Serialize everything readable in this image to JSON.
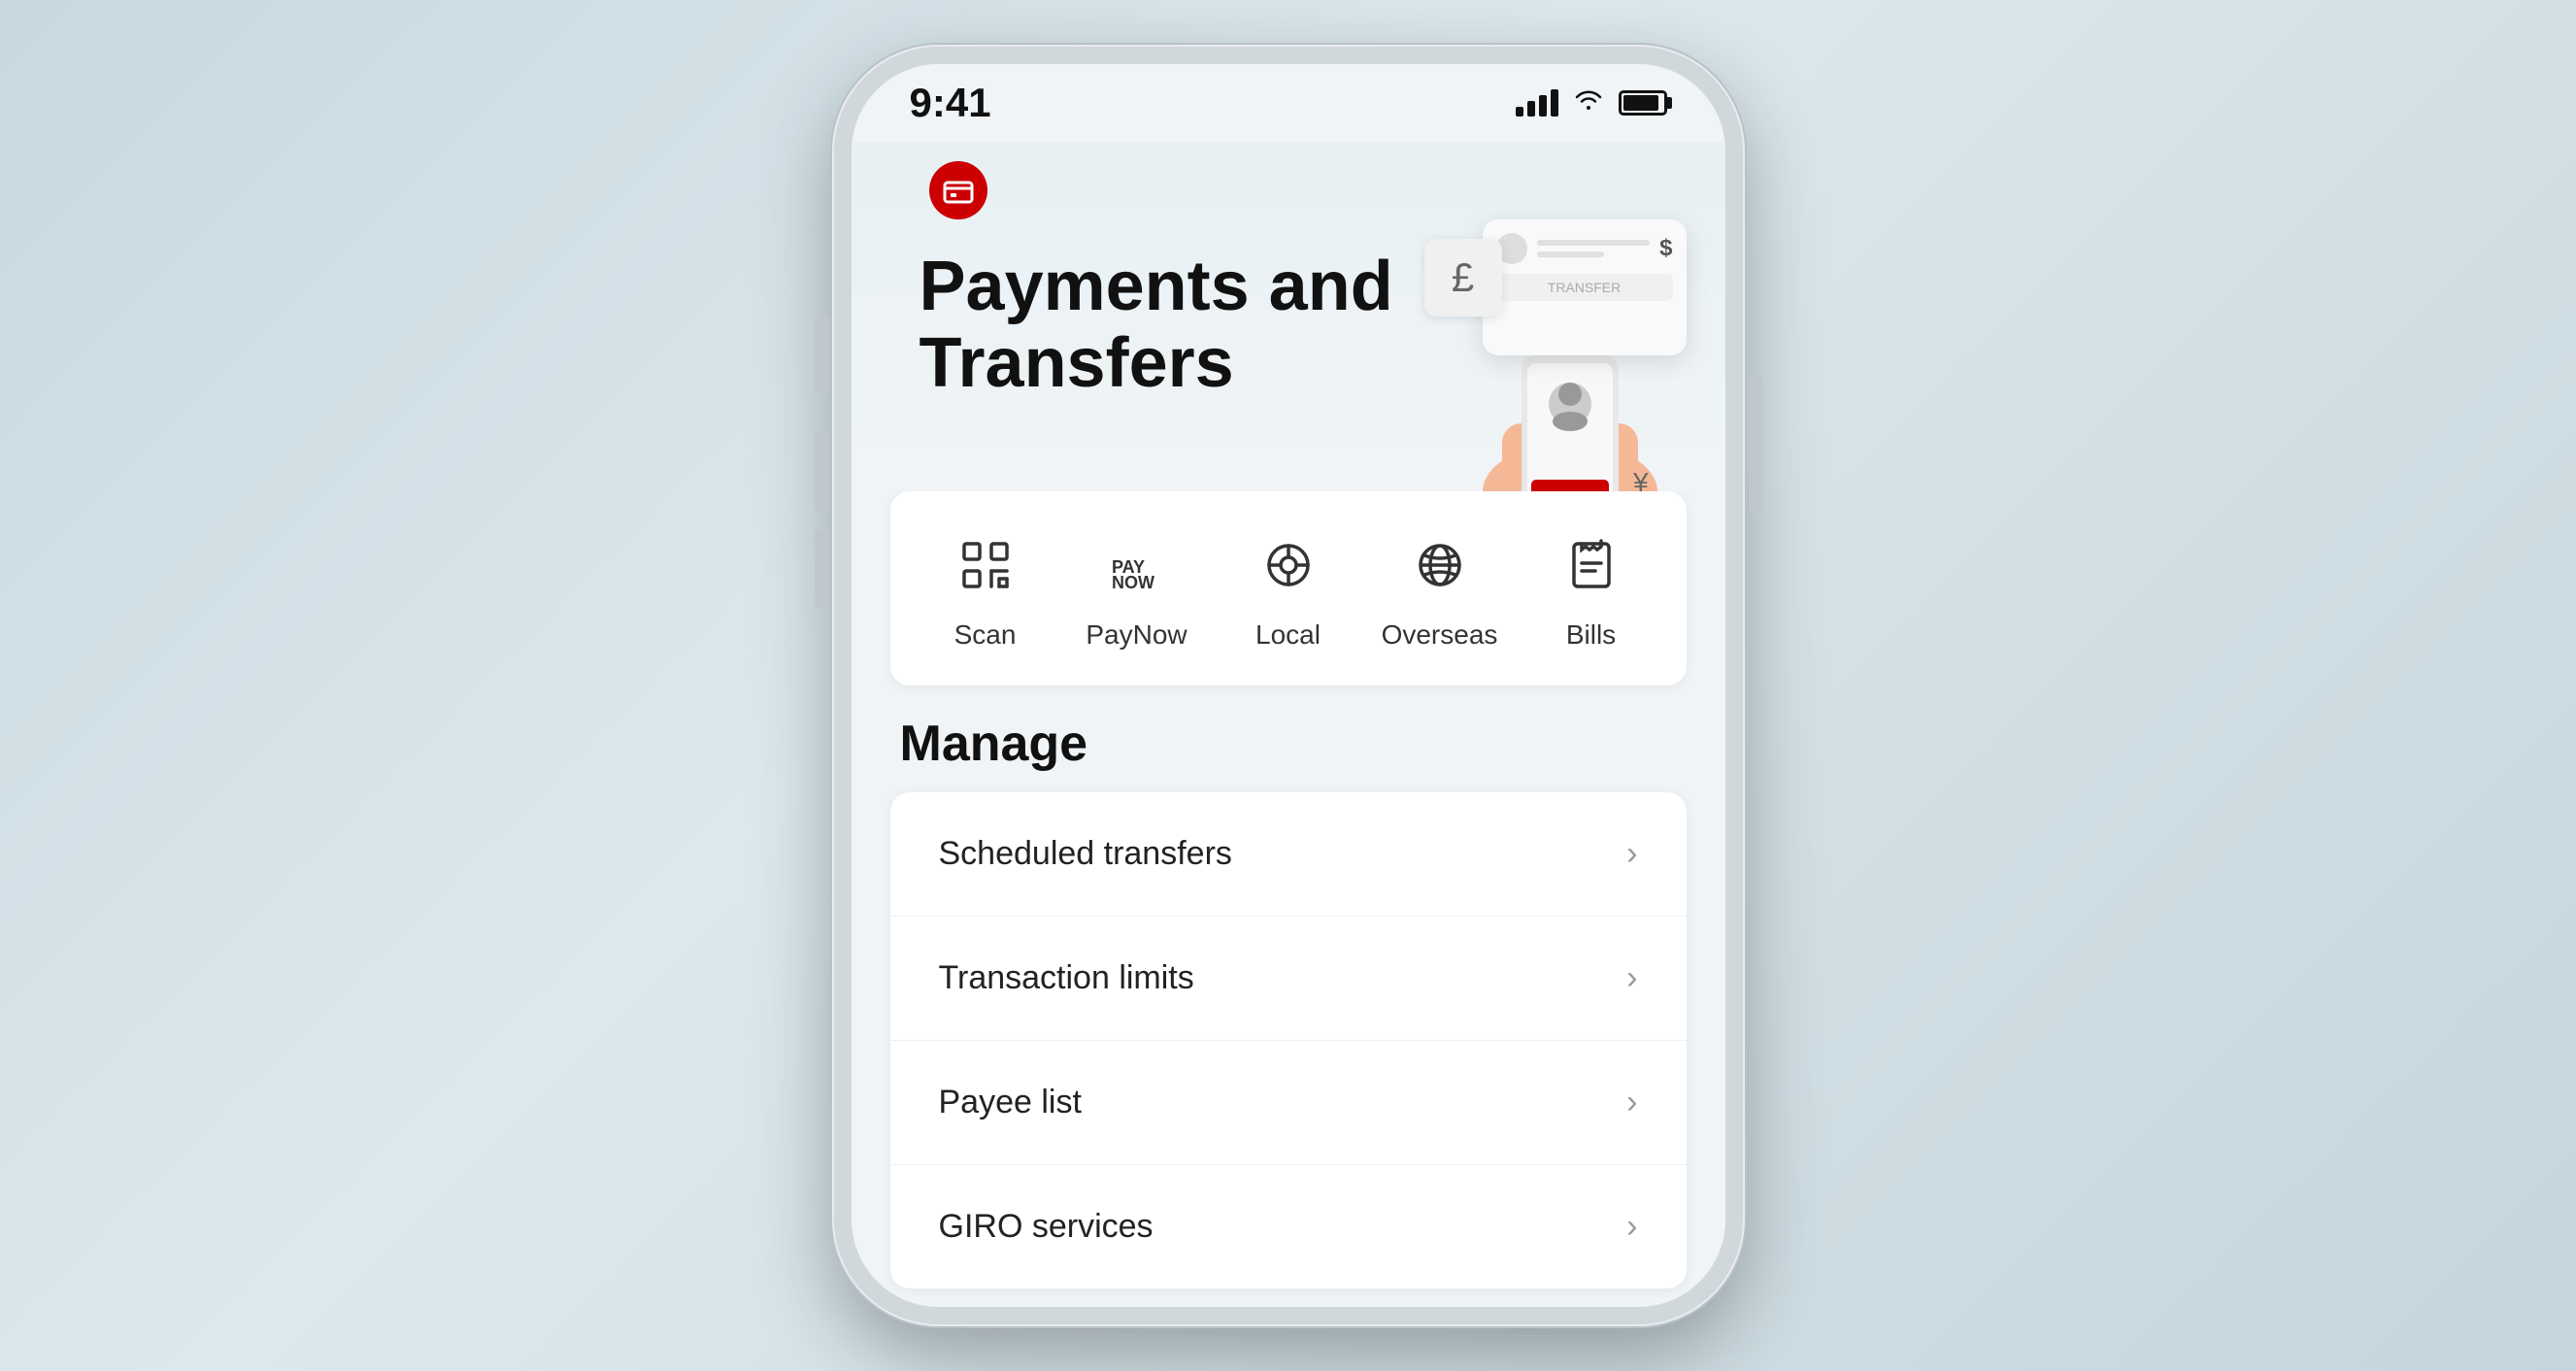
{
  "statusBar": {
    "time": "9:41",
    "signal": "signal-icon",
    "wifi": "wifi-icon",
    "battery": "battery-icon"
  },
  "hero": {
    "title_line1": "Payments and",
    "title_line2": "Transfers",
    "bankLogo": "🏦"
  },
  "quickActions": [
    {
      "id": "scan",
      "label": "Scan",
      "icon": "scan-icon"
    },
    {
      "id": "paynow",
      "label": "PayNow",
      "icon": "paynow-icon"
    },
    {
      "id": "local",
      "label": "Local",
      "icon": "local-icon"
    },
    {
      "id": "overseas",
      "label": "Overseas",
      "icon": "overseas-icon"
    },
    {
      "id": "bills",
      "label": "Bills",
      "icon": "bills-icon"
    }
  ],
  "manage": {
    "sectionTitle": "Manage",
    "items": [
      {
        "id": "scheduled-transfers",
        "label": "Scheduled transfers"
      },
      {
        "id": "transaction-limits",
        "label": "Transaction limits"
      },
      {
        "id": "payee-list",
        "label": "Payee list"
      },
      {
        "id": "giro-services",
        "label": "GIRO services"
      }
    ]
  }
}
